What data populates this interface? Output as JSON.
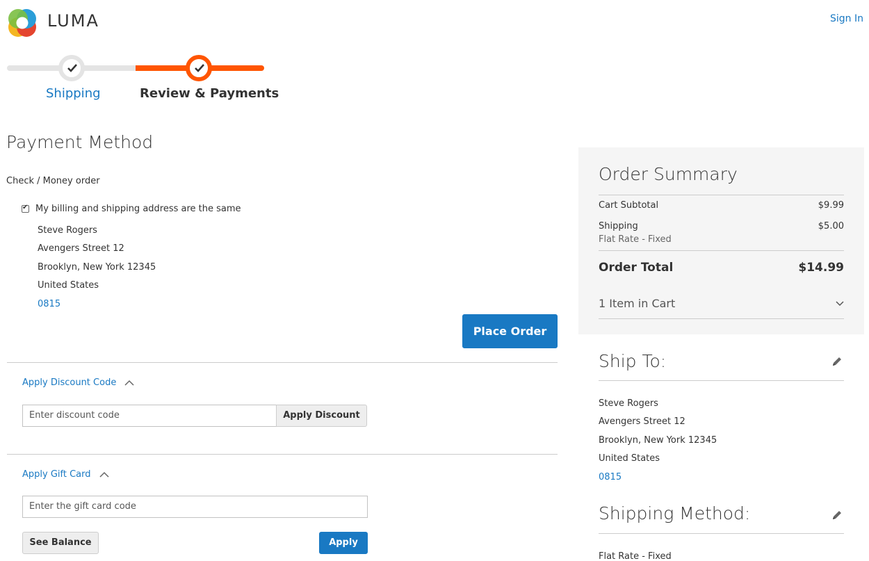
{
  "header": {
    "logo_text": "LUMA",
    "sign_in": "Sign In"
  },
  "progress": {
    "steps": [
      {
        "label": "Shipping",
        "state": "complete"
      },
      {
        "label": "Review & Payments",
        "state": "active"
      }
    ]
  },
  "payment": {
    "title": "Payment Method",
    "method_name": "Check / Money order",
    "same_address_label": "My billing and shipping address are the same",
    "same_address_checked": true,
    "address": {
      "name": "Steve Rogers",
      "street": "Avengers Street 12",
      "city_line": "Brooklyn, New York 12345",
      "country": "United States",
      "phone": "0815"
    },
    "place_order": "Place Order"
  },
  "discount": {
    "toggle_label": "Apply Discount Code",
    "placeholder": "Enter discount code",
    "button": "Apply Discount"
  },
  "gift_card": {
    "toggle_label": "Apply Gift Card",
    "placeholder": "Enter the gift card code",
    "see_balance": "See Balance",
    "apply": "Apply"
  },
  "summary": {
    "title": "Order Summary",
    "cart_subtotal_label": "Cart Subtotal",
    "cart_subtotal_value": "$9.99",
    "shipping_label": "Shipping",
    "shipping_value": "$5.00",
    "shipping_method": "Flat Rate - Fixed",
    "order_total_label": "Order Total",
    "order_total_value": "$14.99",
    "items_in_cart": "1 Item in Cart"
  },
  "ship_to": {
    "title": "Ship To:",
    "name": "Steve Rogers",
    "street": "Avengers Street 12",
    "city_line": "Brooklyn, New York 12345",
    "country": "United States",
    "phone": "0815"
  },
  "shipping_method": {
    "title": "Shipping Method:",
    "value": "Flat Rate - Fixed"
  },
  "colors": {
    "accent": "#1979c3",
    "progress_active": "#ff5501"
  }
}
